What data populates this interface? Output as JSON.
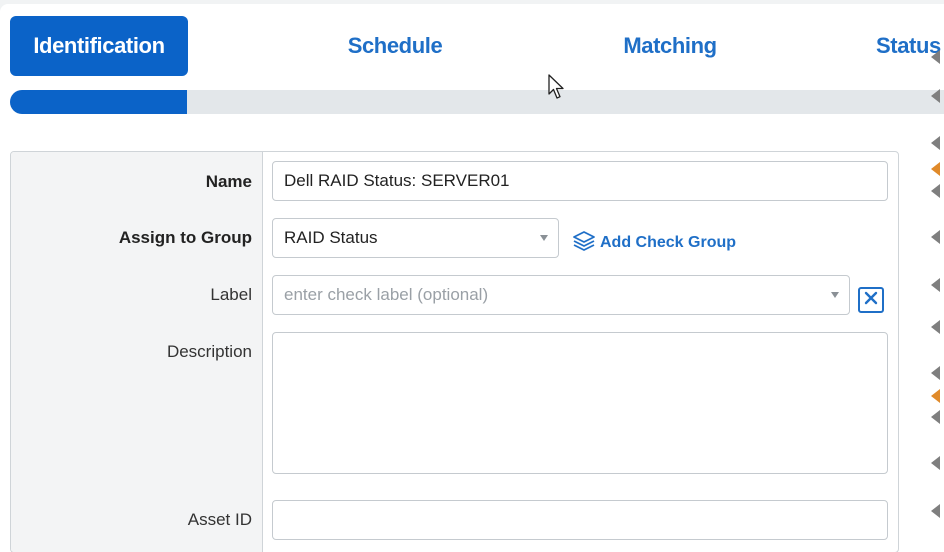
{
  "tabs": [
    {
      "label": "Identification",
      "active": true
    },
    {
      "label": "Schedule",
      "active": false
    },
    {
      "label": "Matching",
      "active": false
    },
    {
      "label": "Status",
      "active": false
    }
  ],
  "progress": {
    "fraction": 0.19
  },
  "form": {
    "name": {
      "label": "Name",
      "value": "Dell RAID Status: SERVER01"
    },
    "group": {
      "label": "Assign to Group",
      "value": "RAID Status",
      "add_label": "Add Check Group"
    },
    "check_label": {
      "label": "Label",
      "placeholder": "enter check label (optional)"
    },
    "description": {
      "label": "Description",
      "value": ""
    },
    "asset_id": {
      "label": "Asset ID",
      "value": ""
    }
  },
  "icons": {
    "layers": "layers-icon",
    "clear": "close-box-icon",
    "cursor": "mouse-pointer-icon"
  },
  "colors": {
    "accent": "#0b63c8",
    "link": "#1f6fc7"
  }
}
